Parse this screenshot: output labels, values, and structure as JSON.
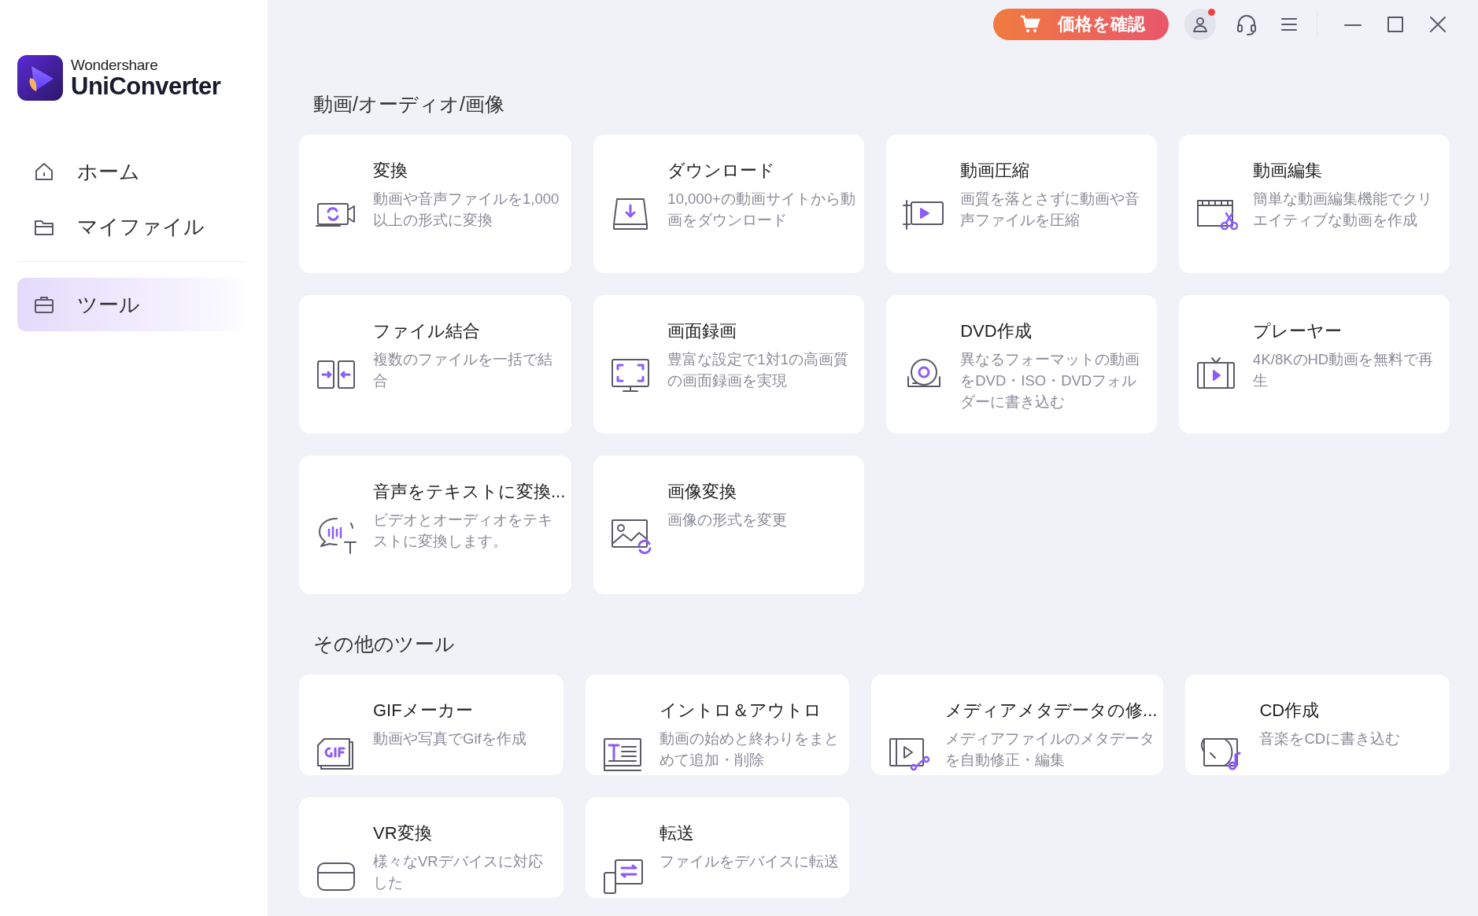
{
  "app": {
    "brand": "Wondershare",
    "name": "UniConverter"
  },
  "topbar": {
    "price_button": "価格を確認",
    "account_notification": true
  },
  "sidebar": {
    "main_items": [
      {
        "label": "ホーム",
        "selected": false
      },
      {
        "label": "マイファイル",
        "selected": false
      }
    ],
    "lower_items": [
      {
        "label": "ツール",
        "selected": true
      }
    ]
  },
  "sections": [
    {
      "title": "動画/オーディオ/画像",
      "tools": [
        {
          "title": "変換",
          "description": "動画や音声ファイルを1,000以上の形式に変換"
        },
        {
          "title": "ダウンロード",
          "description": "10,000+の動画サイトから動画をダウンロード"
        },
        {
          "title": "動画圧縮",
          "description": "画質を落とさずに動画や音声ファイルを圧縮"
        },
        {
          "title": "動画編集",
          "description": "簡単な動画編集機能でクリエイティブな動画を作成"
        },
        {
          "title": "ファイル結合",
          "description": "複数のファイルを一括で結合"
        },
        {
          "title": "画面録画",
          "description": "豊富な設定で1対1の高画質の画面録画を実現"
        },
        {
          "title": "DVD作成",
          "description": "異なるフォーマットの動画をDVD・ISO・DVDフォルダーに書き込む"
        },
        {
          "title": "プレーヤー",
          "description": "4K/8KのHD動画を無料で再生"
        },
        {
          "title": "音声をテキストに変換...",
          "description": "ビデオとオーディオをテキストに変換します。"
        },
        {
          "title": "画像変換",
          "description": "画像の形式を変更"
        }
      ]
    },
    {
      "title": "その他のツール",
      "tools": [
        {
          "title": "GIFメーカー",
          "description": "動画や写真でGifを作成"
        },
        {
          "title": "イントロ＆アウトロ",
          "description": "動画の始めと終わりをまとめて追加・削除"
        },
        {
          "title": "メディアメタデータの修...",
          "description": "メディアファイルのメタデータを自動修正・編集"
        },
        {
          "title": "CD作成",
          "description": "音楽をCDに書き込む"
        },
        {
          "title": "VR変換",
          "description": "様々なVRデバイスに対応した"
        },
        {
          "title": "転送",
          "description": "ファイルをデバイスに転送"
        }
      ]
    }
  ]
}
